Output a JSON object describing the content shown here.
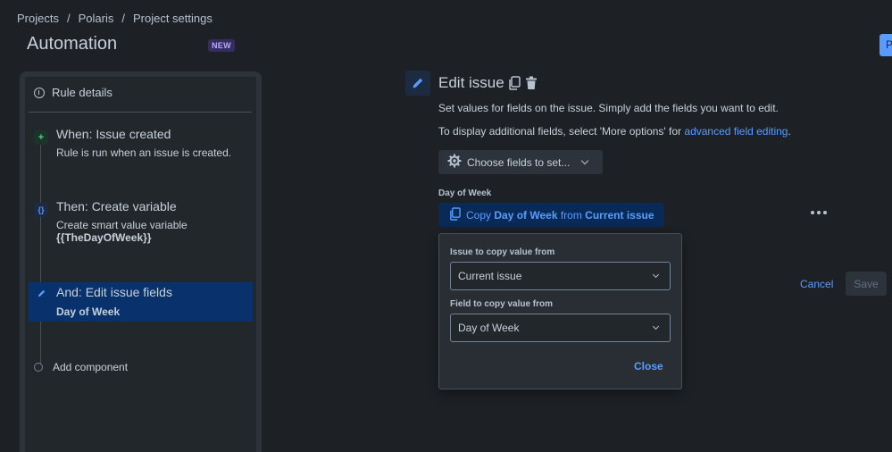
{
  "breadcrumb": [
    "Projects",
    "Polaris",
    "Project settings"
  ],
  "breadcrumb_sep": "/",
  "page": {
    "title": "Automation",
    "badge": "NEW",
    "top_right_button_label": "P"
  },
  "rule_panel": {
    "details_label": "Rule details",
    "steps": [
      {
        "title": "When: Issue created",
        "desc": "Rule is run when an issue is created.",
        "icon": "plus-icon",
        "icon_glyph": "+"
      },
      {
        "title": "Then: Create variable",
        "desc": "Create smart value variable",
        "desc_bold": "{{TheDayOfWeek}}",
        "icon": "braces-icon",
        "icon_glyph": "{}"
      },
      {
        "title": "And: Edit issue fields",
        "desc": "Day of Week",
        "icon": "pencil-icon"
      }
    ],
    "add_component": "Add component"
  },
  "editor": {
    "title": "Edit issue",
    "desc1": "Set values for fields on the issue. Simply add the fields you want to edit.",
    "desc2_prefix": "To display additional fields, select 'More options' for ",
    "desc2_link": "advanced field editing",
    "desc2_suffix": ".",
    "choose_fields_label": "Choose fields to set...",
    "field_label": "Day of Week",
    "copy_pill": {
      "prefix": "Copy ",
      "field": "Day of Week",
      "mid": " from ",
      "source": "Current issue"
    }
  },
  "popup": {
    "issue_label": "Issue to copy value from",
    "issue_value": "Current issue",
    "field_label": "Field to copy value from",
    "field_value": "Day of Week",
    "close_label": "Close"
  },
  "actions": {
    "cancel": "Cancel",
    "save": "Save"
  },
  "colors": {
    "accent": "#579dff",
    "selected": "#09326c",
    "background": "#1d2125"
  }
}
